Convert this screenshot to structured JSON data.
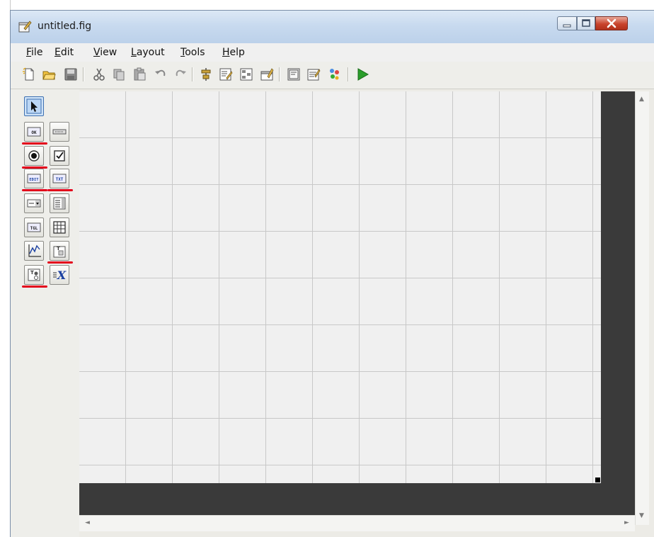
{
  "window": {
    "title": "untitled.fig"
  },
  "menubar": {
    "items": [
      {
        "label": "File",
        "mnemonic": "F",
        "rest": "ile"
      },
      {
        "label": "Edit",
        "mnemonic": "E",
        "rest": "dit"
      },
      {
        "label": "View",
        "mnemonic": "V",
        "rest": "iew"
      },
      {
        "label": "Layout",
        "mnemonic": "L",
        "rest": "ayout"
      },
      {
        "label": "Tools",
        "mnemonic": "T",
        "rest": "ools"
      },
      {
        "label": "Help",
        "mnemonic": "H",
        "rest": "elp"
      }
    ]
  },
  "toolbar": {
    "icons": [
      "new-figure-icon",
      "open-file-icon",
      "save-icon",
      "cut-icon",
      "copy-icon",
      "paste-icon",
      "undo-icon",
      "redo-icon",
      "align-objects-icon",
      "menu-editor-icon",
      "tab-order-editor-icon",
      "toolbar-editor-icon",
      "mfile-editor-icon",
      "property-inspector-icon",
      "object-browser-icon",
      "run-figure-icon"
    ]
  },
  "palette": {
    "components": [
      {
        "name": "select-tool",
        "glyph": "arrow",
        "selected": true
      },
      {
        "name": "push-button",
        "glyph": "OK",
        "highlighted": true
      },
      {
        "name": "slider",
        "glyph": "slider"
      },
      {
        "name": "radio-button",
        "glyph": "radio",
        "highlighted": true
      },
      {
        "name": "check-box",
        "glyph": "check"
      },
      {
        "name": "edit-text",
        "glyph": "EDIT",
        "highlighted": true
      },
      {
        "name": "static-text",
        "glyph": "TXT",
        "highlighted": true
      },
      {
        "name": "pop-up-menu",
        "glyph": "popup"
      },
      {
        "name": "list-box",
        "glyph": "list"
      },
      {
        "name": "toggle-button",
        "glyph": "TGL"
      },
      {
        "name": "table",
        "glyph": "table"
      },
      {
        "name": "axes",
        "glyph": "axes"
      },
      {
        "name": "panel",
        "glyph": "panel",
        "highlighted": true
      },
      {
        "name": "button-group",
        "glyph": "button-group",
        "highlighted": true
      },
      {
        "name": "activex-control",
        "glyph": "X"
      }
    ],
    "glyphs": {
      "ok": "OK",
      "edit": "EDIT",
      "txt": "TXT",
      "tgl": "TGL",
      "x": "X",
      "t": "T"
    }
  },
  "colors": {
    "highlight_underline": "#e3001b",
    "run_arrow": "#2a9d2a",
    "canvas_background": "#f0f0f0",
    "grid_line": "#c8c8c8",
    "dark_border": "#3a3a3a"
  },
  "scroll": {
    "up": "▲",
    "down": "▼",
    "left": "◄",
    "right": "►"
  }
}
